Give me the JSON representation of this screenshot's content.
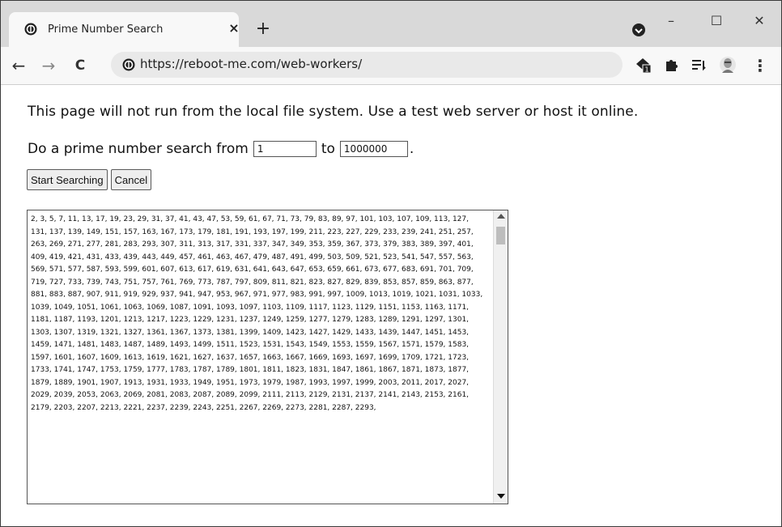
{
  "browser": {
    "tab_title": "Prime Number Search",
    "tab_close": "×",
    "new_tab": "+",
    "url": "https://reboot-me.com/web-workers/",
    "window_controls": {
      "minimize": "–",
      "maximize": "☐",
      "close": "✕"
    },
    "nav": {
      "back": "←",
      "forward": "→",
      "reload": "C",
      "menu": "⋮"
    },
    "extension_badge": "1",
    "icons": [
      "tab-favicon-icon",
      "profile-icon",
      "site-info-icon",
      "extension-icon",
      "puzzle-icon",
      "reading-list-icon",
      "avatar-icon",
      "menu-icon"
    ]
  },
  "page": {
    "notice": "This page will not run from the local file system. Use a test web server or host it online.",
    "search_prefix": "Do a prime number search from",
    "search_middle": "to",
    "search_suffix": ".",
    "from_value": "1",
    "to_value": "1000000",
    "start_button": "Start Searching",
    "cancel_button": "Cancel",
    "results": "2, 3, 5, 7, 11, 13, 17, 19, 23, 29, 31, 37, 41, 43, 47, 53, 59, 61, 67, 71, 73, 79, 83, 89, 97, 101, 103, 107, 109, 113, 127, 131, 137, 139, 149, 151, 157, 163, 167, 173, 179, 181, 191, 193, 197, 199, 211, 223, 227, 229, 233, 239, 241, 251, 257, 263, 269, 271, 277, 281, 283, 293, 307, 311, 313, 317, 331, 337, 347, 349, 353, 359, 367, 373, 379, 383, 389, 397, 401, 409, 419, 421, 431, 433, 439, 443, 449, 457, 461, 463, 467, 479, 487, 491, 499, 503, 509, 521, 523, 541, 547, 557, 563, 569, 571, 577, 587, 593, 599, 601, 607, 613, 617, 619, 631, 641, 643, 647, 653, 659, 661, 673, 677, 683, 691, 701, 709, 719, 727, 733, 739, 743, 751, 757, 761, 769, 773, 787, 797, 809, 811, 821, 823, 827, 829, 839, 853, 857, 859, 863, 877, 881, 883, 887, 907, 911, 919, 929, 937, 941, 947, 953, 967, 971, 977, 983, 991, 997, 1009, 1013, 1019, 1021, 1031, 1033, 1039, 1049, 1051, 1061, 1063, 1069, 1087, 1091, 1093, 1097, 1103, 1109, 1117, 1123, 1129, 1151, 1153, 1163, 1171, 1181, 1187, 1193, 1201, 1213, 1217, 1223, 1229, 1231, 1237, 1249, 1259, 1277, 1279, 1283, 1289, 1291, 1297, 1301, 1303, 1307, 1319, 1321, 1327, 1361, 1367, 1373, 1381, 1399, 1409, 1423, 1427, 1429, 1433, 1439, 1447, 1451, 1453, 1459, 1471, 1481, 1483, 1487, 1489, 1493, 1499, 1511, 1523, 1531, 1543, 1549, 1553, 1559, 1567, 1571, 1579, 1583, 1597, 1601, 1607, 1609, 1613, 1619, 1621, 1627, 1637, 1657, 1663, 1667, 1669, 1693, 1697, 1699, 1709, 1721, 1723, 1733, 1741, 1747, 1753, 1759, 1777, 1783, 1787, 1789, 1801, 1811, 1823, 1831, 1847, 1861, 1867, 1871, 1873, 1877, 1879, 1889, 1901, 1907, 1913, 1931, 1933, 1949, 1951, 1973, 1979, 1987, 1993, 1997, 1999, 2003, 2011, 2017, 2027, 2029, 2039, 2053, 2063, 2069, 2081, 2083, 2087, 2089, 2099, 2111, 2113, 2129, 2131, 2137, 2141, 2143, 2153, 2161, 2179, 2203, 2207, 2213, 2221, 2237, 2239, 2243, 2251, 2267, 2269, 2273, 2281, 2287, 2293,"
  }
}
